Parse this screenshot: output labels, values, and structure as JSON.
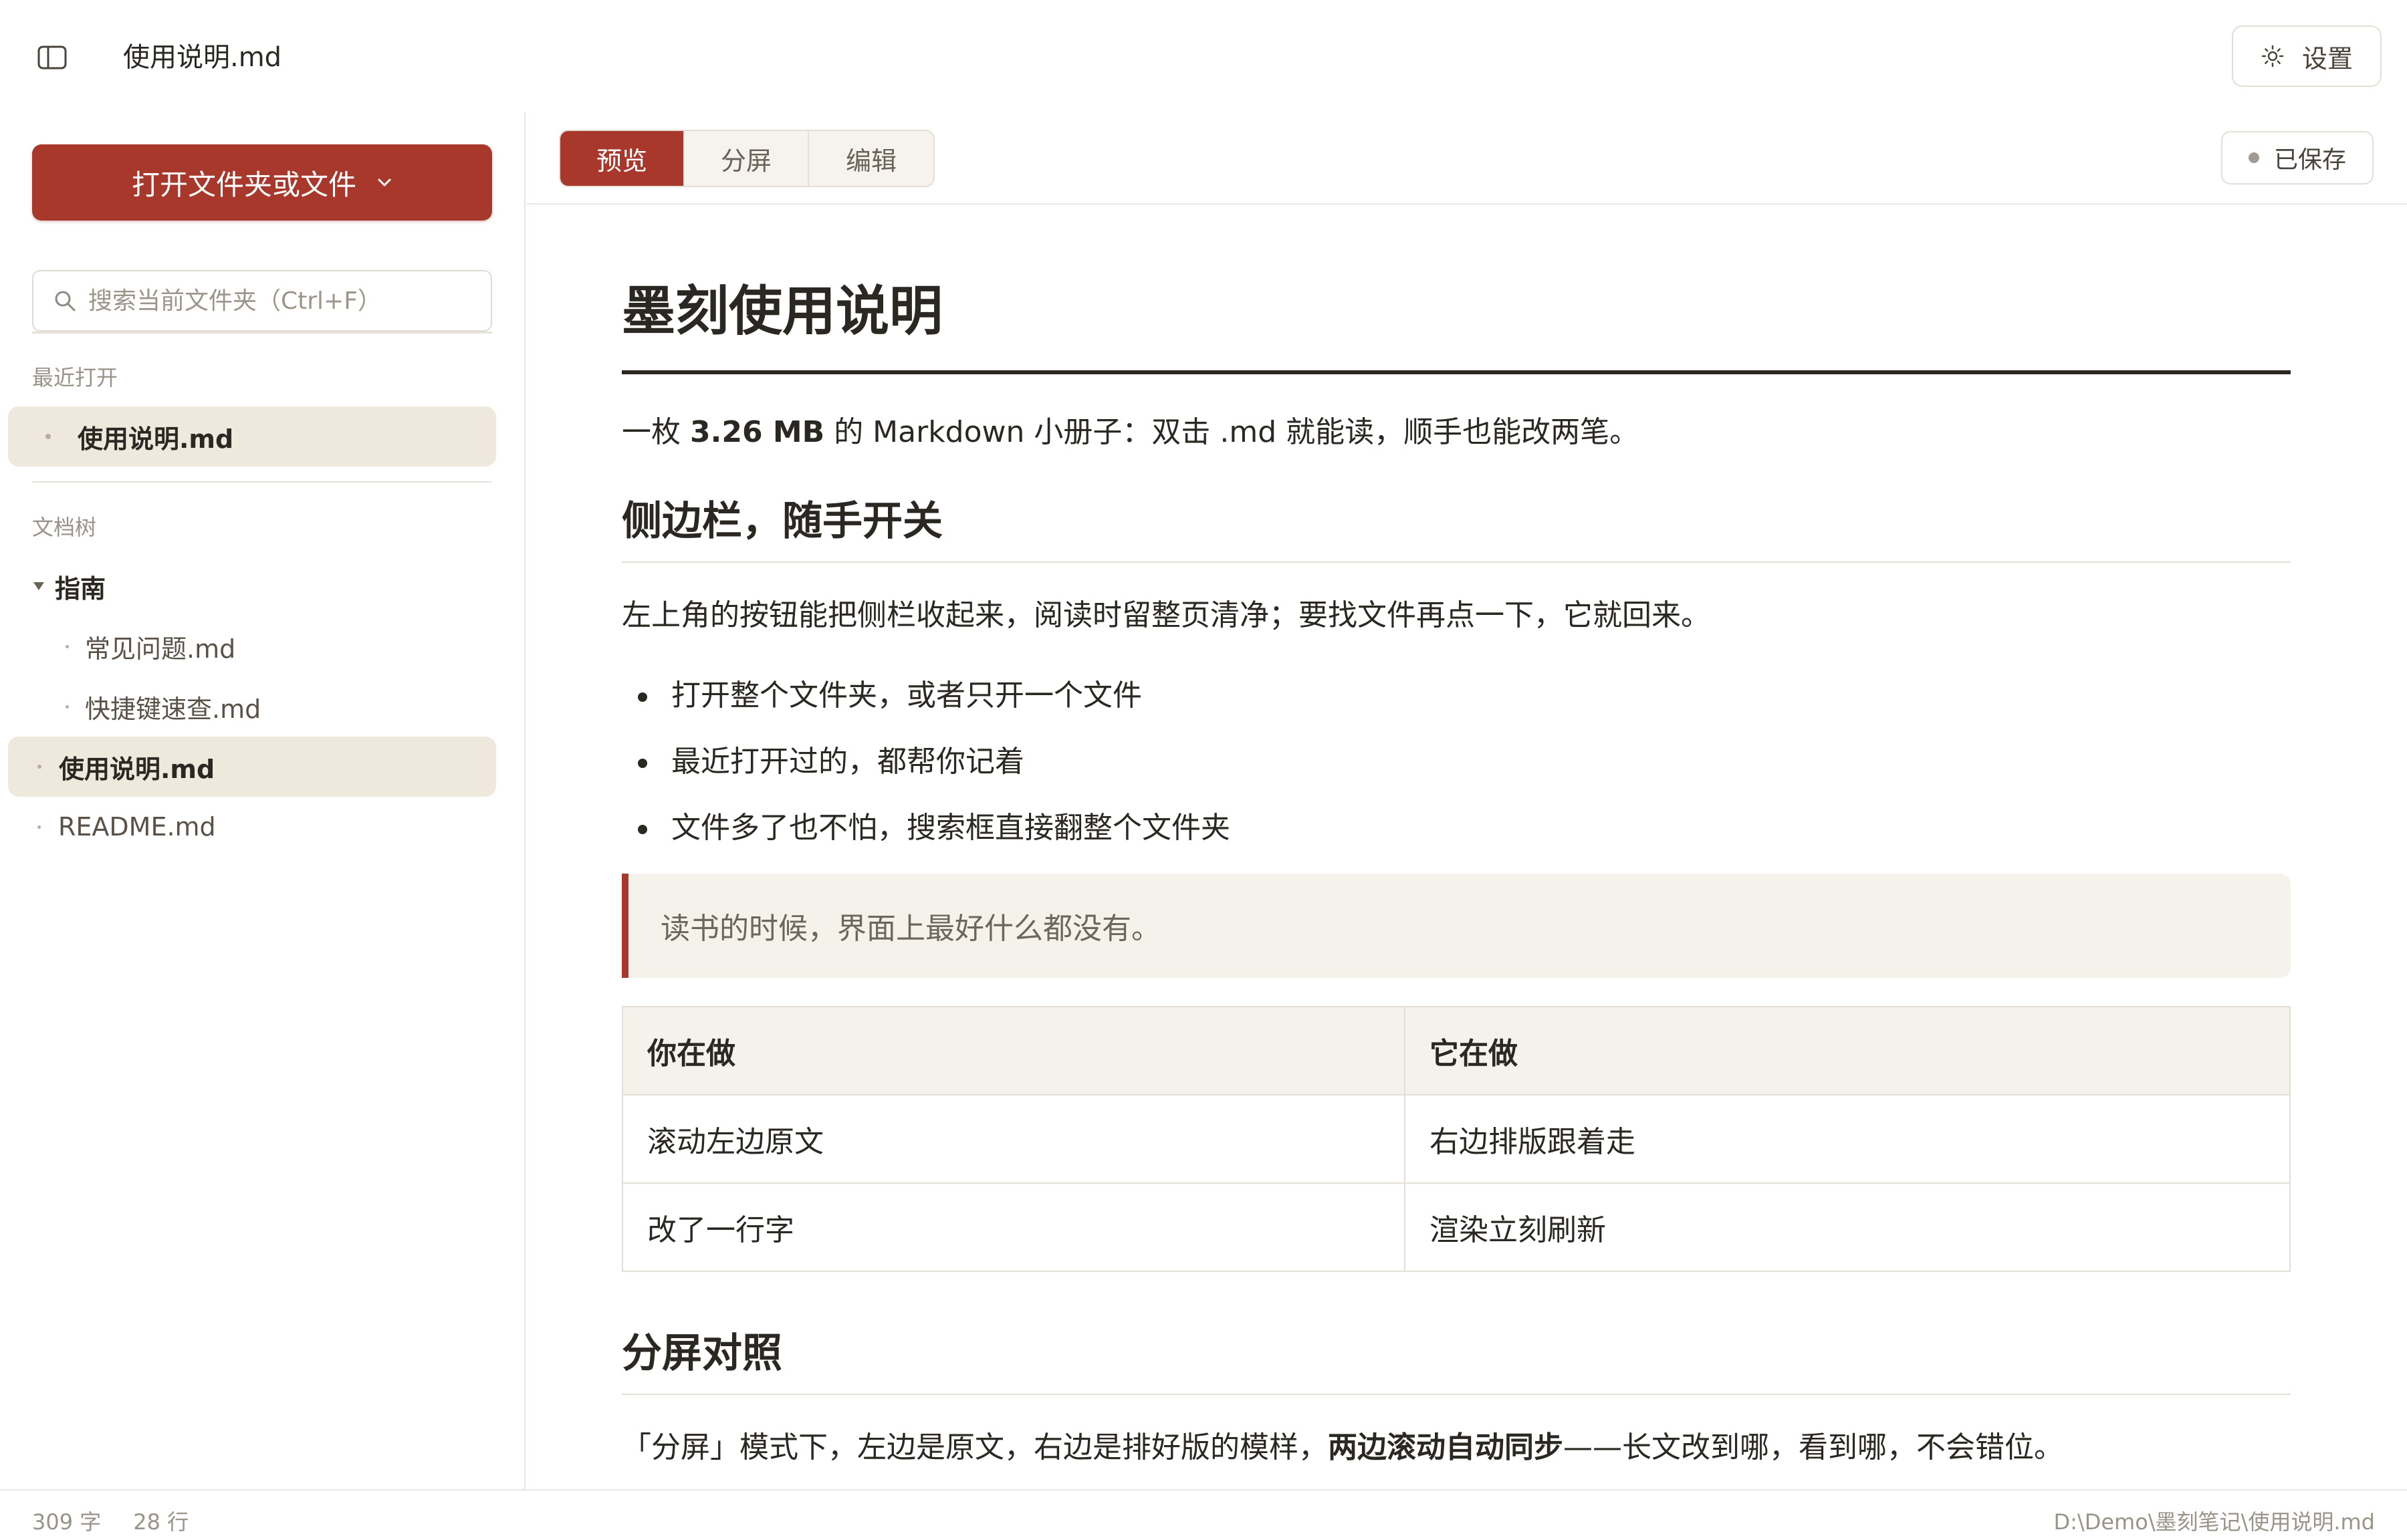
{
  "window": {
    "title": "使用说明.md"
  },
  "header": {
    "settings_label": "设置"
  },
  "sidebar": {
    "open_button_label": "打开文件夹或文件",
    "search_placeholder": "搜索当前文件夹（Ctrl+F）",
    "recent_label": "最近打开",
    "recent_items": [
      {
        "label": "使用说明.md",
        "active": true
      }
    ],
    "tree_label": "文档树",
    "tree": {
      "folder": "指南",
      "children": [
        "常见问题.md",
        "快捷键速查.md"
      ],
      "files": [
        {
          "label": "使用说明.md",
          "active": true
        },
        {
          "label": "README.md",
          "active": false
        }
      ]
    }
  },
  "main": {
    "tabs": [
      {
        "label": "预览",
        "active": true
      },
      {
        "label": "分屏",
        "active": false
      },
      {
        "label": "编辑",
        "active": false
      }
    ],
    "saved_label": "已保存",
    "doc": {
      "h1": "墨刻使用说明",
      "intro_pre": "一枚 ",
      "intro_bold": "3.26 MB",
      "intro_post": " 的 Markdown 小册子：双击 .md 就能读，顺手也能改两笔。",
      "h2_sidebar": "侧边栏，随手开关",
      "sidebar_para": "左上角的按钮能把侧栏收起来，阅读时留整页清净；要找文件再点一下，它就回来。",
      "bullets": [
        "打开整个文件夹，或者只开一个文件",
        "最近打开过的，都帮你记着",
        "文件多了也不怕，搜索框直接翻整个文件夹"
      ],
      "quote": "读书的时候，界面上最好什么都没有。",
      "table": {
        "headers": [
          "你在做",
          "它在做"
        ],
        "rows": [
          [
            "滚动左边原文",
            "右边排版跟着走"
          ],
          [
            "改了一行字",
            "渲染立刻刷新"
          ]
        ]
      },
      "h2_split": "分屏对照",
      "split_para_pre": "「分屏」模式下，左边是原文，右边是排好版的模样，",
      "split_para_bold": "两边滚动自动同步",
      "split_para_post": "——长文改到哪，看到哪，不会错位。"
    }
  },
  "status": {
    "chars": "309 字",
    "lines": "28 行",
    "path": "D:\\Demo\\墨刻笔记\\使用说明.md"
  },
  "colors": {
    "accent": "#a8382c",
    "active_bg": "#efe8dc",
    "quote_bg": "#f5f2ec"
  }
}
